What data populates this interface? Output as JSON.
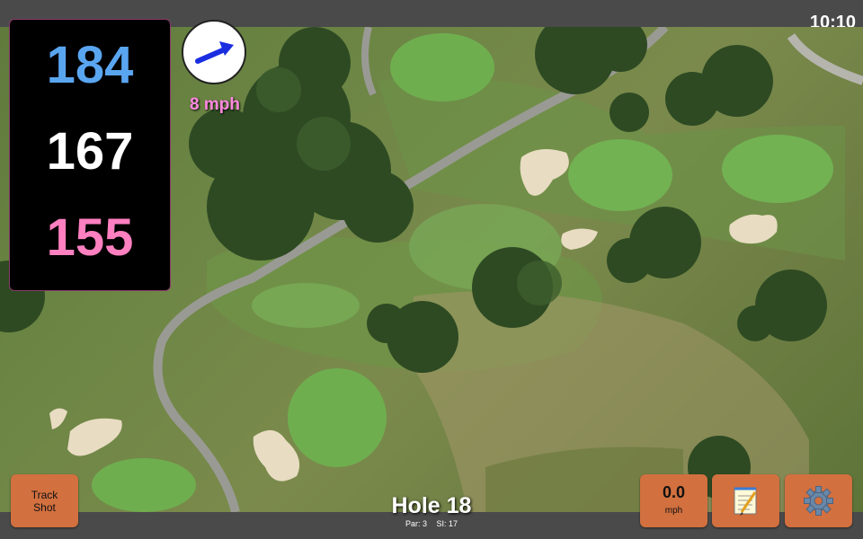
{
  "status_bar": {
    "time": "10:10"
  },
  "distances": {
    "back": "184",
    "middle": "167",
    "front": "155"
  },
  "wind": {
    "speed": "8 mph",
    "direction_icon": "arrow-icon"
  },
  "hole": {
    "title": "Hole 18",
    "par": "Par: 3",
    "stroke_index": "SI: 17"
  },
  "buttons": {
    "track_shot": "Track\nShot",
    "speed_value": "0.0",
    "speed_unit": "mph",
    "notes_icon": "notepad-icon",
    "settings_icon": "gear-icon"
  },
  "colors": {
    "back_distance": "#5aa5f0",
    "middle_distance": "#ffffff",
    "front_distance": "#ff80c0",
    "button": "#d2703f",
    "wind_text": "#ff88e0"
  }
}
